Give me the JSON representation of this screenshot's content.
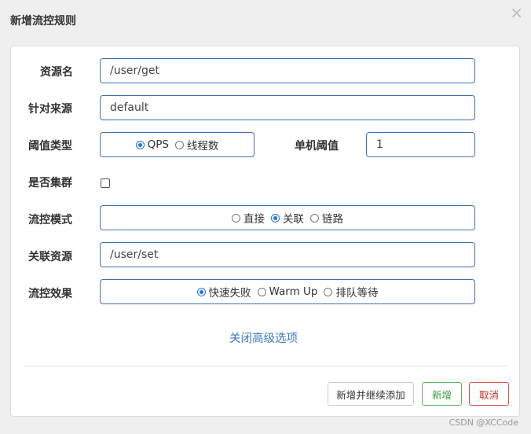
{
  "dialog": {
    "title": "新增流控规则",
    "close_glyph": "×"
  },
  "form": {
    "resource_name": {
      "label": "资源名",
      "value": "/user/get"
    },
    "limit_app": {
      "label": "针对来源",
      "value": "default"
    },
    "threshold_type": {
      "label": "阈值类型",
      "options": [
        {
          "label": "QPS",
          "selected": true
        },
        {
          "label": "线程数",
          "selected": false
        }
      ]
    },
    "single_threshold": {
      "label": "单机阈值",
      "value": "1"
    },
    "cluster": {
      "label": "是否集群",
      "checked": false
    },
    "strategy": {
      "label": "流控模式",
      "options": [
        {
          "label": "直接",
          "selected": false
        },
        {
          "label": "关联",
          "selected": true
        },
        {
          "label": "链路",
          "selected": false
        }
      ]
    },
    "ref_resource": {
      "label": "关联资源",
      "value": "/user/set"
    },
    "control_behavior": {
      "label": "流控效果",
      "options": [
        {
          "label": "快速失败",
          "selected": true
        },
        {
          "label": "Warm Up",
          "selected": false
        },
        {
          "label": "排队等待",
          "selected": false
        }
      ]
    },
    "advanced_link": "关闭高级选项"
  },
  "footer": {
    "add_continue_label": "新增并继续添加",
    "add_label": "新增",
    "cancel_label": "取消"
  },
  "watermark": "CSDN @XCCode",
  "colors": {
    "input_border": "#3f72af",
    "radio_selected": "#1a73e8",
    "link": "#3a7bbf",
    "success": "#5cb85c",
    "danger": "#d9534f"
  }
}
